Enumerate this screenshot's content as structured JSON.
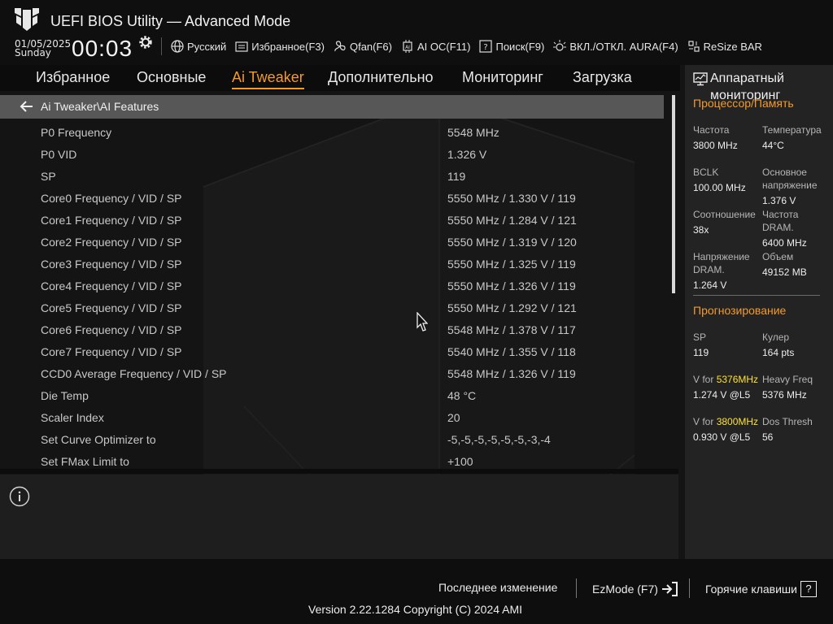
{
  "app": {
    "title": "UEFI BIOS Utility — Advanced Mode"
  },
  "clock": {
    "date": "01/05/2025",
    "day": "Sunday",
    "time": "00:03"
  },
  "toolbar": [
    {
      "icon": "globe-icon",
      "label": "Русский"
    },
    {
      "icon": "favorites-icon",
      "label": "Избранное(F3)"
    },
    {
      "icon": "fan-icon",
      "label": "Qfan(F6)"
    },
    {
      "icon": "ai-oc-icon",
      "label": "AI OC(F11)"
    },
    {
      "icon": "search-icon",
      "label": "Поиск(F9)"
    },
    {
      "icon": "aura-icon",
      "label": "ВКЛ./ОТКЛ. AURA(F4)"
    },
    {
      "icon": "resize-bar-icon",
      "label": "ReSize BAR"
    }
  ],
  "nav": {
    "tabs": [
      {
        "label": "Избранное",
        "active": false
      },
      {
        "label": "Основные",
        "active": false
      },
      {
        "label": "Ai Tweaker",
        "active": true
      },
      {
        "label": "Дополнительно",
        "active": false
      },
      {
        "label": "Мониторинг",
        "active": false
      },
      {
        "label": "Загрузка",
        "active": false
      }
    ]
  },
  "breadcrumb": "Ai Tweaker\\AI Features",
  "settings": [
    {
      "label": "P0 Frequency",
      "value": "5548 MHz"
    },
    {
      "label": "P0 VID",
      "value": "1.326 V"
    },
    {
      "label": "SP",
      "value": "119"
    },
    {
      "label": "Core0 Frequency / VID / SP",
      "value": "5550 MHz / 1.330 V / 119"
    },
    {
      "label": "Core1 Frequency / VID / SP",
      "value": "5550 MHz / 1.284 V / 121"
    },
    {
      "label": "Core2 Frequency / VID / SP",
      "value": "5550 MHz / 1.319 V / 120"
    },
    {
      "label": "Core3 Frequency / VID / SP",
      "value": "5550 MHz / 1.325 V / 119"
    },
    {
      "label": "Core4 Frequency / VID / SP",
      "value": "5550 MHz / 1.326 V / 119"
    },
    {
      "label": "Core5 Frequency / VID / SP",
      "value": "5550 MHz / 1.292 V / 121"
    },
    {
      "label": "Core6 Frequency / VID / SP",
      "value": "5548 MHz / 1.378 V / 117"
    },
    {
      "label": "Core7 Frequency / VID / SP",
      "value": "5540 MHz / 1.355 V / 118"
    },
    {
      "label": "CCD0 Average Frequency / VID / SP",
      "value": "5548 MHz / 1.326 V / 119"
    },
    {
      "label": "Die Temp",
      "value": "48 °C"
    },
    {
      "label": "Scaler Index",
      "value": "20"
    },
    {
      "label": "Set Curve Optimizer to",
      "value": "-5,-5,-5,-5,-5,-5,-3,-4"
    },
    {
      "label": "Set FMax Limit to",
      "value": "+100"
    }
  ],
  "monitor": {
    "title": "Аппаратный мониторинг",
    "cpu_mem": {
      "title": "Процессор/Память",
      "freq_label": "Частота",
      "freq": "3800 MHz",
      "temp_label": "Температура",
      "temp": "44°C",
      "bclk_label": "BCLK",
      "bclk": "100.00 MHz",
      "vcore_label": "Основное напряжение",
      "vcore": "1.376 V",
      "ratio_label": "Соотношение",
      "ratio": "38x",
      "dram_freq_label": "Частота DRAM.",
      "dram_freq": "6400 MHz",
      "dram_volt_label": "Напряжение DRAM.",
      "dram_volt": "1.264 V",
      "capacity_label": "Объем",
      "capacity": "49152 MB"
    },
    "forecast": {
      "title": "Прогнозирование",
      "sp_label": "SP",
      "sp": "119",
      "cooler_label": "Кулер",
      "cooler": "164 pts",
      "v1_prefix": "V for ",
      "v1_freq": "5376MHz",
      "v1": "1.274 V @L5",
      "heavy_label": "Heavy Freq",
      "heavy": "5376 MHz",
      "v2_prefix": "V for ",
      "v2_freq": "3800MHz",
      "v2": "0.930 V @L5",
      "dos_label": "Dos Thresh",
      "dos": "56"
    }
  },
  "footer": {
    "last_change": "Последнее изменение",
    "ezmode": "EzMode (F7)",
    "hotkeys": "Горячие клавиши",
    "hotkeys_key": "?",
    "version": "Version 2.22.1284 Copyright (C) 2024 AMI"
  },
  "colors": {
    "accent": "#f39a2b",
    "highlight": "#ffe033",
    "row_highlight": "#575757"
  }
}
